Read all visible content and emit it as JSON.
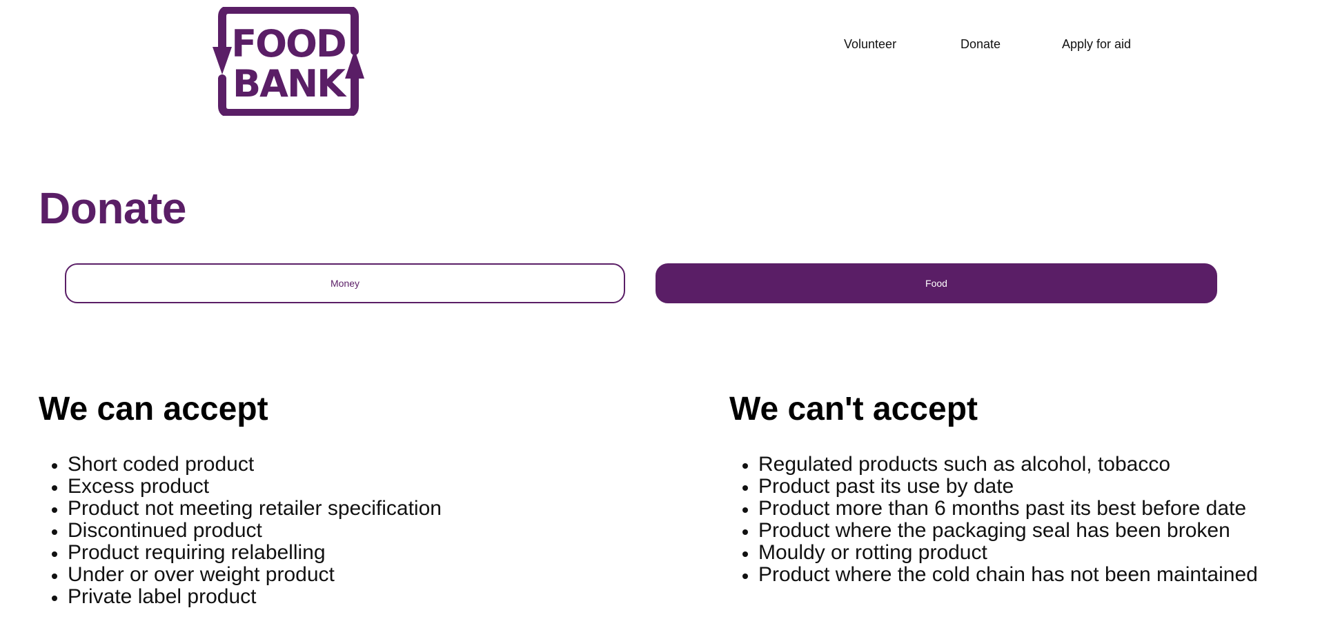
{
  "brand": {
    "logo_line1": "FOOD",
    "logo_line2": "BANK",
    "color": "#5a1e66"
  },
  "nav": {
    "items": [
      {
        "label": "Volunteer"
      },
      {
        "label": "Donate"
      },
      {
        "label": "Apply for aid"
      }
    ]
  },
  "page": {
    "title": "Donate"
  },
  "toggle": {
    "options": [
      {
        "label": "Money",
        "selected": false
      },
      {
        "label": "Food",
        "selected": true
      }
    ]
  },
  "accept": {
    "heading": "We can accept",
    "items": [
      "Short coded product",
      "Excess product",
      "Product not meeting retailer specification",
      "Discontinued product",
      "Product requiring relabelling",
      "Under or over weight product",
      "Private label product"
    ]
  },
  "reject": {
    "heading": "We can't accept",
    "items": [
      "Regulated products such as alcohol, tobacco",
      "Product past its use by date",
      "Product more than 6 months past its best before date",
      "Product where the packaging seal has been broken",
      "Mouldy or rotting product",
      "Product where the cold chain has not been maintained"
    ]
  }
}
